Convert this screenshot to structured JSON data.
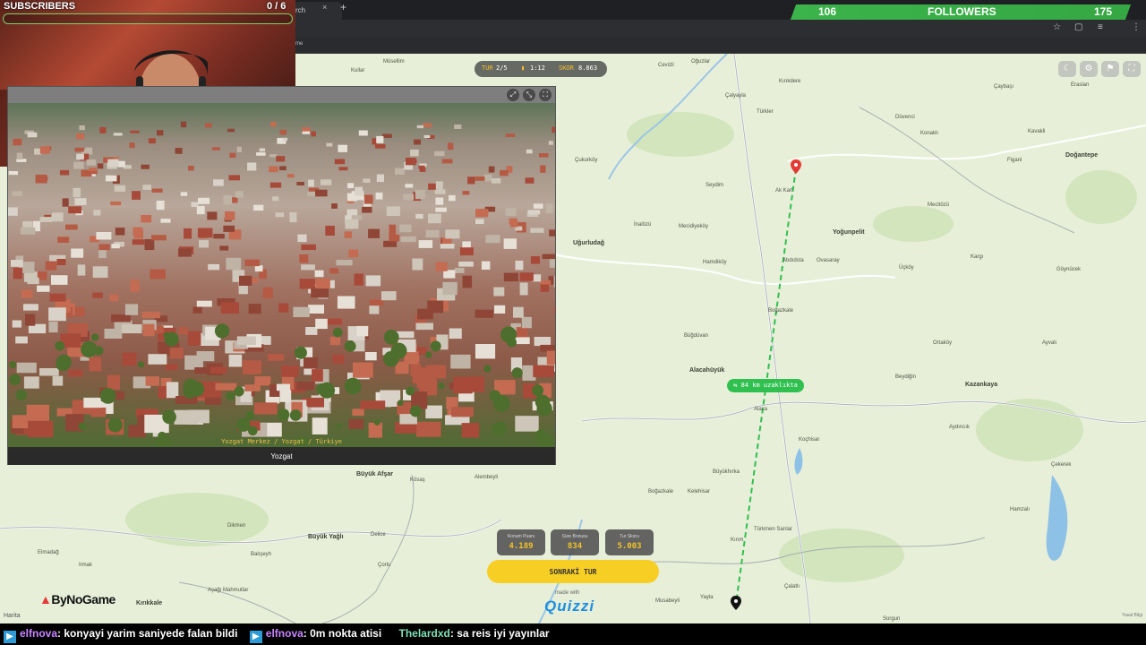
{
  "browser": {
    "tab_title": "rch",
    "tab_close": "×",
    "new_tab": "+",
    "bookmark": "me"
  },
  "overlay": {
    "subscribers_label": "SUBSCRIBERS",
    "subscribers_count": "0 / 6",
    "subscribers_progress": 0,
    "followers_current": "106",
    "followers_label": "FOLLOWERS",
    "followers_target": "175",
    "brand": "ByNoGame"
  },
  "hud": {
    "round_label": "TUR",
    "round_value": "2/5",
    "timer": "1:12",
    "score_label": "SKOR",
    "score_value": "8.863"
  },
  "photo": {
    "location_path": "Yozgat Merkez / Yozgat / Türkiye",
    "caption": "Yozgat"
  },
  "map": {
    "distance_label": "84 km uzaklıkta",
    "attribution": "Harita",
    "legal": "Yasal Bilgi",
    "places": [
      "Kullar",
      "Müsellim",
      "Oğuzlar",
      "Cevizli",
      "Kırıkdere",
      "Çaybaşı",
      "Eraslan",
      "Çalyayla",
      "Türkler",
      "Düvenci",
      "Konaklı",
      "Kavakli",
      "Doğantepe",
      "Çukurköy",
      "Seydim",
      "Ak Karl",
      "Mecitözü",
      "Figani",
      "Uğurludağ",
      "İnalözü",
      "Mecidiyeköy",
      "Yoğunpelit",
      "Kargı",
      "Göynücek",
      "Hamdiköy",
      "Abdıdsta",
      "Ovasaray",
      "Üçköy",
      "Boğazkale",
      "Kelehisar",
      "Büğdüvan",
      "Ortaköy",
      "Ayvalı",
      "Alacahüyük",
      "Alaca",
      "Beydiğin",
      "Kazankaya",
      "Koçhisar",
      "Aydıncık",
      "Çekerek",
      "Büyükhırka",
      "Boğazkale",
      "Büyük Afşar",
      "Alembeyli",
      "Dikmen",
      "Büyük Yağlı",
      "Delice",
      "Türkmen Sarılar",
      "Kırım",
      "Çalatlı",
      "Musabeyli",
      "Yayla",
      "Sorgun",
      "Irmak",
      "Elmadağ",
      "Balışeyh",
      "Çorlu",
      "Kırıkkale",
      "Aşağı Mahmutlar",
      "Kösaş",
      "Hamzalı"
    ]
  },
  "results": {
    "cards": [
      {
        "label": "Konum Puanı",
        "value": "4.189"
      },
      {
        "label": "Süre Bonusu",
        "value": "834"
      },
      {
        "label": "Tur Skoru",
        "value": "5.003"
      }
    ],
    "next_button": "SONRAKİ TUR",
    "made_with": "made with",
    "logo": "Quizzi"
  },
  "chat": {
    "messages": [
      {
        "user": "elfnova",
        "text": ": konyayi yarim saniyede falan bildi"
      },
      {
        "user": "elfnova",
        "text": ": 0m nokta atisi"
      },
      {
        "user": "Thelardxd",
        "text": ": sa reis iyi yayınlar"
      }
    ]
  },
  "colors": {
    "accent_yellow": "#f7cf24",
    "followers_green": "#3bb44a",
    "route_green": "#30c04f",
    "map_bg": "#e7efd9",
    "pin_red": "#e53935"
  },
  "icons": [
    "close-icon",
    "plus-icon",
    "star-icon",
    "extensions-icon",
    "expand-icon",
    "fullscreen-icon",
    "settings-icon",
    "flag-icon",
    "moon-icon",
    "pin-icon",
    "twitch-icon"
  ]
}
